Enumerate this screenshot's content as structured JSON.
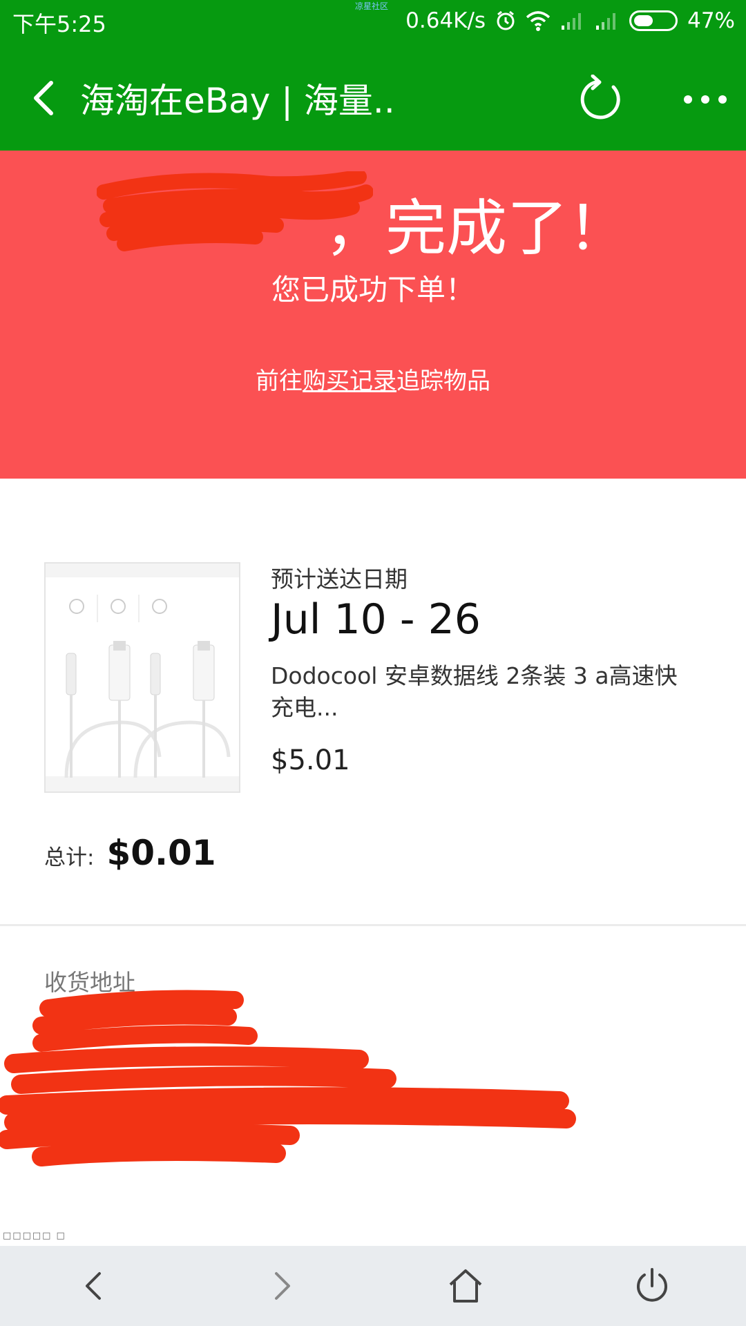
{
  "status_bar": {
    "time": "下午5:25",
    "watermark": "凉星社区",
    "net_speed": "0.64K/s",
    "battery_percent": "47%",
    "battery_level": 0.47,
    "icons": [
      "alarm-icon",
      "wifi-icon",
      "signal-icon",
      "signal-icon",
      "battery-icon"
    ]
  },
  "title_bar": {
    "title": "海淘在eBay | 海量..",
    "icons": [
      "back-icon",
      "refresh-icon",
      "more-icon"
    ]
  },
  "banner": {
    "heading": "，完成了！",
    "subheading": "您已成功下单！",
    "link_prefix": "前往",
    "link_text": "购买记录",
    "link_suffix": "追踪物品",
    "color": "#fb5153"
  },
  "order": {
    "eta_label": "预计送达日期",
    "eta_date": "Jul 10 - 26",
    "item_title": "Dodocool 安卓数据线 2条装 3 a高速快充电...",
    "item_price": "$5.01",
    "total_label": "总计:",
    "total_value": "$0.01"
  },
  "address": {
    "label": "收货地址"
  },
  "bottom_nav": {
    "icons": [
      "back-arrow-icon",
      "forward-arrow-icon",
      "home-icon",
      "power-icon"
    ]
  },
  "colors": {
    "green": "#069a10",
    "red_banner": "#fb5153",
    "scribble": "#f23314",
    "nav_bg": "#e9ecef"
  }
}
